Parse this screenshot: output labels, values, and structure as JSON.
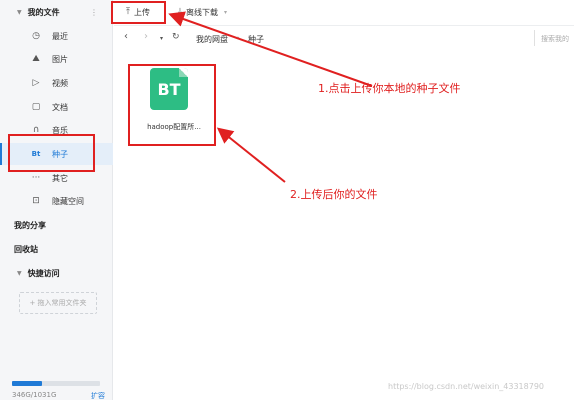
{
  "sidebar": {
    "my_files": "我的文件",
    "items": [
      {
        "label": "最近",
        "icon": "clock-icon"
      },
      {
        "label": "图片",
        "icon": "image-icon"
      },
      {
        "label": "视频",
        "icon": "play-icon"
      },
      {
        "label": "文档",
        "icon": "document-icon"
      },
      {
        "label": "音乐",
        "icon": "headphones-icon"
      },
      {
        "label": "种子",
        "icon": "bt-icon",
        "icon_text": "Bt"
      },
      {
        "label": "其它",
        "icon": "more-icon"
      },
      {
        "label": "隐藏空间",
        "icon": "lock-icon"
      }
    ],
    "my_share": "我的分享",
    "recycle_bin": "回收站",
    "quick_access": "快捷访问",
    "drop_hint": "+ 拖入常用文件夹",
    "storage_text": "346G/1031G",
    "storage_used_fraction": 0.336,
    "expand_label": "扩容"
  },
  "toolbar": {
    "upload_label": "上传",
    "offline_label": "离线下载"
  },
  "address": {
    "crumbs": [
      "我的网盘",
      "种子"
    ],
    "search_placeholder": "搜索我的"
  },
  "files": [
    {
      "name": "hadoop配置所...",
      "badge": "BT",
      "badge_color": "#2dbd84"
    }
  ],
  "annotations": {
    "note1": "1.点击上传你本地的种子文件",
    "note2": "2.上传后你的文件",
    "color": "#e02020"
  },
  "accent_color": "#1f7ad6",
  "watermark": "https://blog.csdn.net/weixin_43318790"
}
